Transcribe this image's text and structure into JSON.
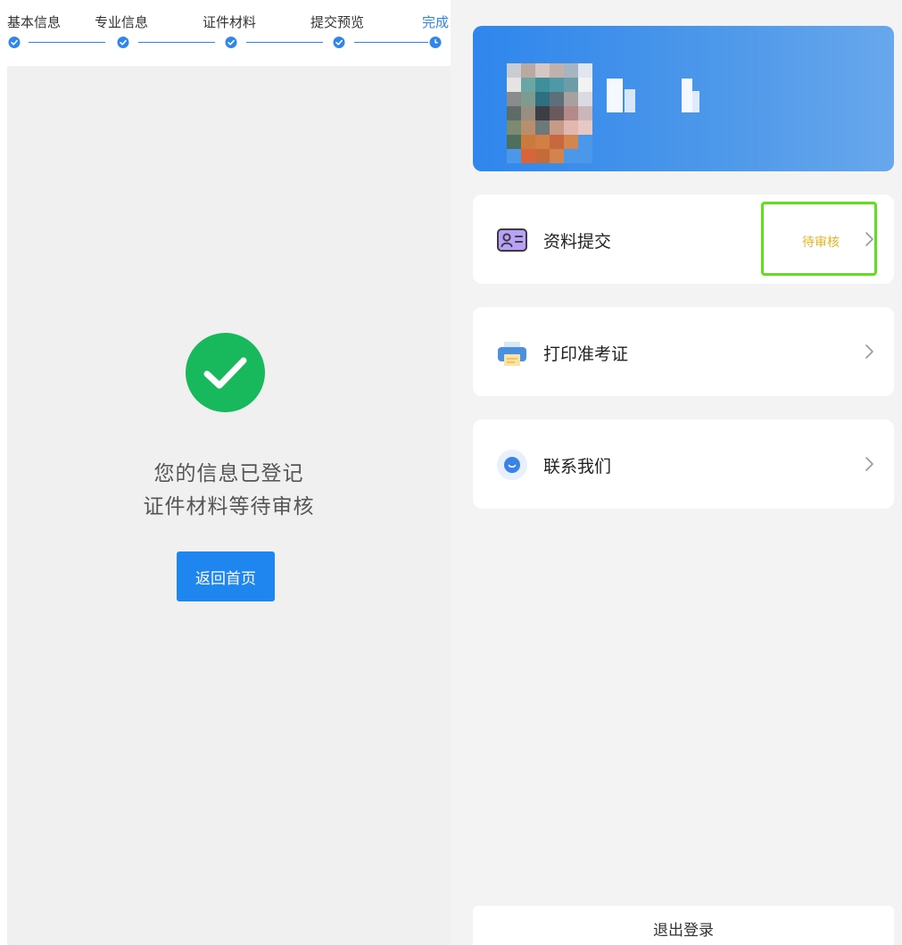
{
  "steps": {
    "items": [
      {
        "label": "基本信息",
        "state": "done"
      },
      {
        "label": "专业信息",
        "state": "done"
      },
      {
        "label": "证件材料",
        "state": "done"
      },
      {
        "label": "提交预览",
        "state": "done"
      },
      {
        "label": "完成",
        "state": "current"
      }
    ],
    "accent_color": "#2f86ec"
  },
  "result": {
    "line1": "您的信息已登记",
    "line2": "证件材料等待审核",
    "icon": "check-circle-icon",
    "icon_color": "#18b95d",
    "home_button": "返回首页"
  },
  "profile": {
    "avatar": "blurred-avatar",
    "name_blurred": true
  },
  "menu": {
    "materials": {
      "label": "资料提交",
      "status": "待审核",
      "icon": "id-card-icon"
    },
    "ticket": {
      "label": "打印准考证",
      "icon": "printer-icon"
    },
    "contact": {
      "label": "联系我们",
      "icon": "chat-bubble-icon"
    }
  },
  "logout": {
    "label": "退出登录"
  },
  "colors": {
    "primary": "#1f86f0",
    "status_pending": "#e6b422",
    "highlight": "#5fe01a"
  }
}
